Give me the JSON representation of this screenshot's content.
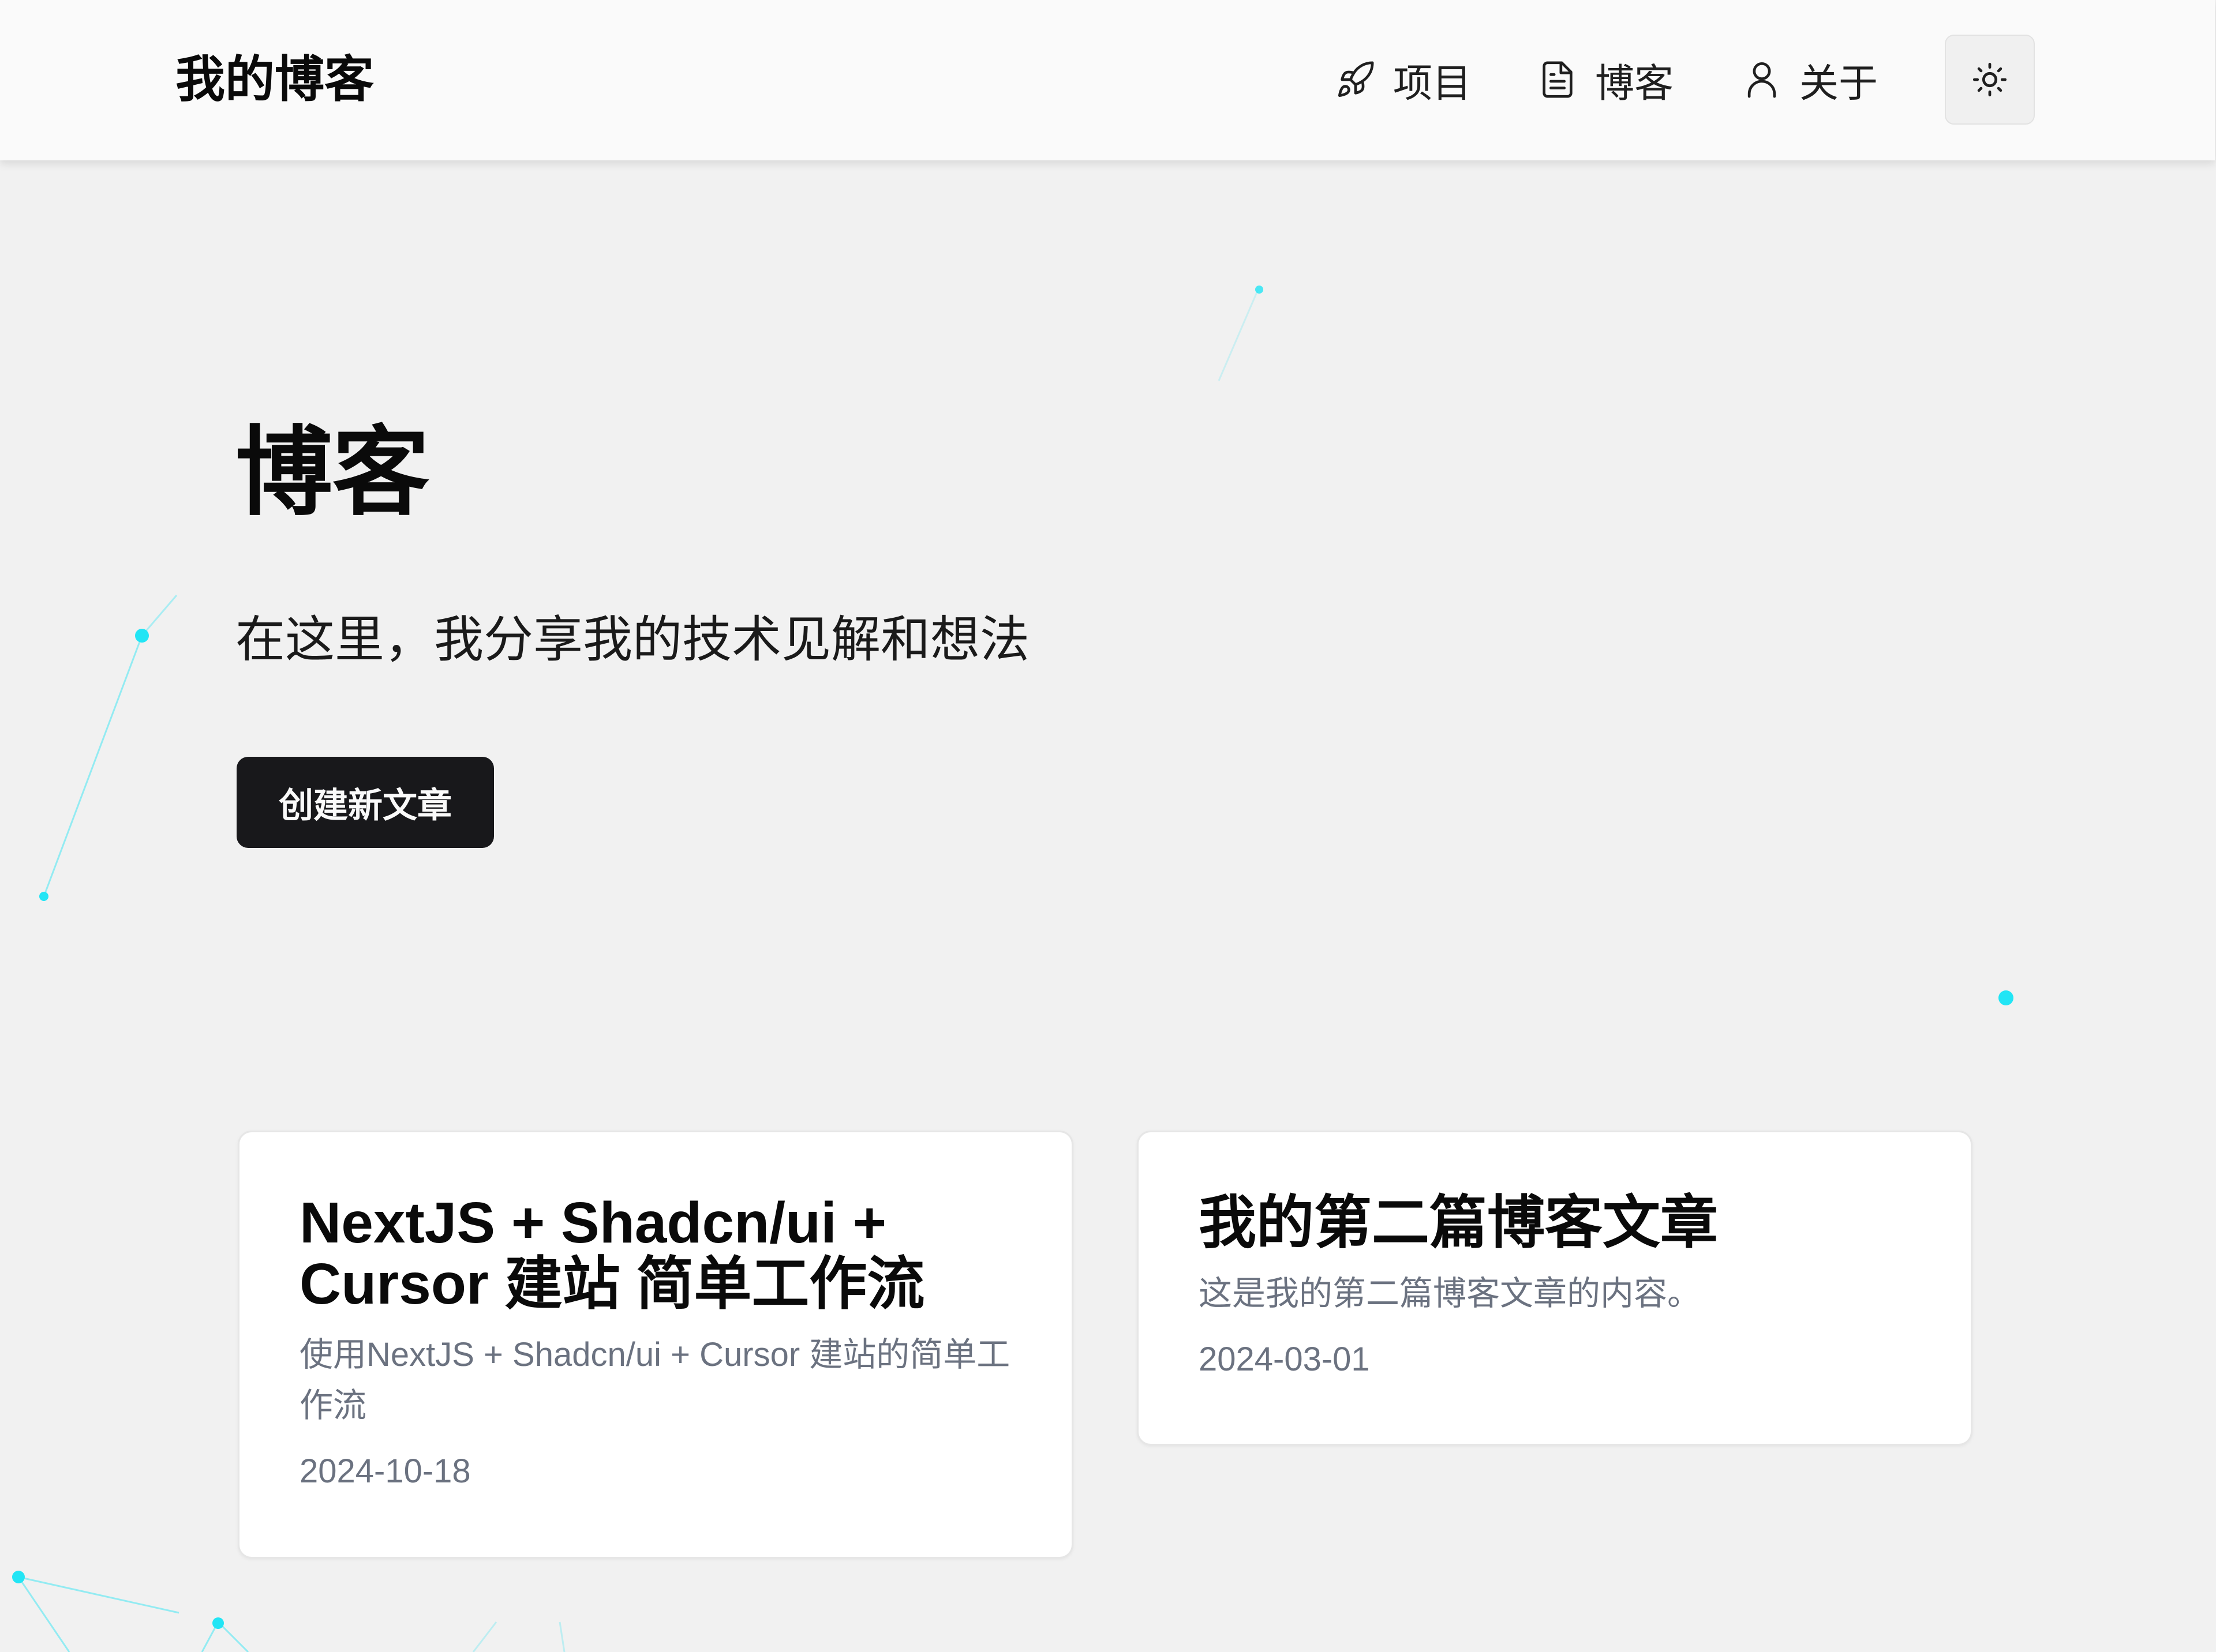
{
  "header": {
    "brand": "我的博客",
    "nav": [
      {
        "label": "项目",
        "icon": "rocket-icon"
      },
      {
        "label": "博客",
        "icon": "document-icon"
      },
      {
        "label": "关于",
        "icon": "user-icon"
      }
    ],
    "theme_toggle_icon": "sun-icon"
  },
  "main": {
    "title": "博客",
    "subtitle": "在这里，我分享我的技术见解和想法",
    "create_button": "创建新文章",
    "posts": [
      {
        "title": "NextJS + Shadcn/ui + Cursor 建站 简单工作流",
        "excerpt": "使用NextJS + Shadcn/ui + Cursor 建站的简单工作流",
        "date": "2024-10-18"
      },
      {
        "title": "我的第二篇博客文章",
        "excerpt": "这是我的第二篇博客文章的内容。",
        "date": "2024-03-01"
      }
    ]
  },
  "colors": {
    "accent": "#22e5f5",
    "page_background": "#f1f1f1",
    "header_background": "#fafafa",
    "button_background": "#18181b",
    "muted_text": "#6b7280"
  }
}
